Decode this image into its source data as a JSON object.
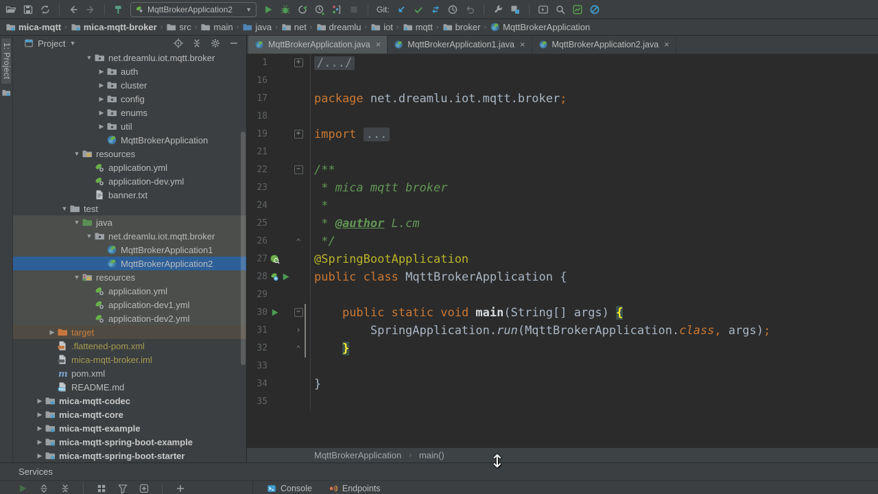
{
  "colors": {
    "selection": "#2d6099",
    "keyword": "#cc7832",
    "annotation": "#bbb529",
    "comment": "#629755",
    "run_green": "#4d9b53",
    "git_blue": "#3f9fd4",
    "excluded_orange": "#c97e3f",
    "ignored_olive": "#a29c4f"
  },
  "toolbar": {
    "run_config": "MqttBrokerApplication2",
    "git_label": "Git:"
  },
  "navbar": {
    "items": [
      {
        "label": "mica-mqtt",
        "icon": "module",
        "bold": true
      },
      {
        "label": "mica-mqtt-broker",
        "icon": "module",
        "bold": true
      },
      {
        "label": "src",
        "icon": "folder"
      },
      {
        "label": "main",
        "icon": "folder"
      },
      {
        "label": "java",
        "icon": "folder-blue"
      },
      {
        "label": "net",
        "icon": "package-crumb"
      },
      {
        "label": "dreamlu",
        "icon": "package-crumb"
      },
      {
        "label": "iot",
        "icon": "package-crumb"
      },
      {
        "label": "mqtt",
        "icon": "package-crumb"
      },
      {
        "label": "broker",
        "icon": "package-crumb"
      },
      {
        "label": "MqttBrokerApplication",
        "icon": "spring"
      }
    ]
  },
  "project": {
    "stripe_label": "1: Project",
    "title": "Project",
    "services_label": "Services",
    "tree": [
      {
        "l": "net.dreamlu.iot.mqtt.broker",
        "i": "package",
        "d": 5,
        "e": "o"
      },
      {
        "l": "auth",
        "i": "package",
        "d": 6,
        "e": "c"
      },
      {
        "l": "cluster",
        "i": "package",
        "d": 6,
        "e": "c"
      },
      {
        "l": "config",
        "i": "package",
        "d": 6,
        "e": "c"
      },
      {
        "l": "enums",
        "i": "package",
        "d": 6,
        "e": "c"
      },
      {
        "l": "util",
        "i": "package",
        "d": 6,
        "e": "c"
      },
      {
        "l": "MqttBrokerApplication",
        "i": "spring",
        "d": 6
      },
      {
        "l": "resources",
        "i": "resources",
        "d": 4,
        "e": "o"
      },
      {
        "l": "application.yml",
        "i": "yml",
        "d": 5
      },
      {
        "l": "application-dev.yml",
        "i": "yml",
        "d": 5
      },
      {
        "l": "banner.txt",
        "i": "txt",
        "d": 5
      },
      {
        "l": "test",
        "i": "folder",
        "d": 3,
        "e": "o"
      },
      {
        "l": "java",
        "i": "folder-green",
        "d": 4,
        "e": "o",
        "s": "hl"
      },
      {
        "l": "net.dreamlu.iot.mqtt.broker",
        "i": "package",
        "d": 5,
        "e": "o",
        "s": "hl"
      },
      {
        "l": "MqttBrokerApplication1",
        "i": "spring",
        "d": 6,
        "s": "hl"
      },
      {
        "l": "MqttBrokerApplication2",
        "i": "spring",
        "d": 6,
        "s": "sel"
      },
      {
        "l": "resources",
        "i": "resources-test",
        "d": 4,
        "e": "o",
        "s": "hl"
      },
      {
        "l": "application.yml",
        "i": "yml",
        "d": 5,
        "s": "hl"
      },
      {
        "l": "application-dev1.yml",
        "i": "yml",
        "d": 5,
        "s": "hl"
      },
      {
        "l": "application-dev2.yml",
        "i": "yml",
        "d": 5,
        "s": "hl"
      },
      {
        "l": "target",
        "i": "folder-orange",
        "d": 2,
        "e": "c",
        "s": "warm",
        "c": "orange"
      },
      {
        "l": ".flattened-pom.xml",
        "i": "xml-file",
        "d": 2,
        "c": "olive"
      },
      {
        "l": "mica-mqtt-broker.iml",
        "i": "iml-file",
        "d": 2,
        "c": "olive"
      },
      {
        "l": "pom.xml",
        "i": "maven",
        "d": 2
      },
      {
        "l": "README.md",
        "i": "md",
        "d": 2
      },
      {
        "l": "mica-mqtt-codec",
        "i": "module",
        "d": 1,
        "e": "c",
        "c": "bold"
      },
      {
        "l": "mica-mqtt-core",
        "i": "module",
        "d": 1,
        "e": "c",
        "c": "bold"
      },
      {
        "l": "mica-mqtt-example",
        "i": "module",
        "d": 1,
        "e": "c",
        "c": "bold"
      },
      {
        "l": "mica-mqtt-spring-boot-example",
        "i": "module",
        "d": 1,
        "e": "c",
        "c": "bold"
      },
      {
        "l": "mica-mqtt-spring-boot-starter",
        "i": "module",
        "d": 1,
        "e": "c",
        "c": "bold"
      }
    ]
  },
  "editor": {
    "tabs": [
      {
        "label": "MqttBrokerApplication.java",
        "icon": "spring",
        "active": true
      },
      {
        "label": "MqttBrokerApplication1.java",
        "icon": "spring",
        "active": false
      },
      {
        "label": "MqttBrokerApplication2.java",
        "icon": "spring",
        "active": false
      }
    ],
    "breadcrumb": [
      "MqttBrokerApplication",
      "main()"
    ],
    "lines": [
      {
        "n": "1",
        "f": "plus",
        "segs": [
          [
            "/.../",
            "folded"
          ]
        ]
      },
      {
        "n": "16",
        "segs": []
      },
      {
        "n": "17",
        "segs": [
          [
            "package",
            "kw"
          ],
          [
            " net.dreamlu.iot.mqtt.broker",
            "pl"
          ],
          [
            ";",
            "kw"
          ]
        ]
      },
      {
        "n": "18",
        "segs": []
      },
      {
        "n": "19",
        "f": "plus",
        "segs": [
          [
            "import",
            "kw"
          ],
          [
            " ",
            "pl"
          ],
          [
            "...",
            "folded"
          ]
        ]
      },
      {
        "n": "21",
        "segs": []
      },
      {
        "n": "22",
        "f": "minus",
        "segs": [
          [
            "/**",
            "doc"
          ]
        ]
      },
      {
        "n": "23",
        "segs": [
          [
            " * ",
            "doc"
          ],
          [
            "mica mqtt broker",
            "doci"
          ]
        ]
      },
      {
        "n": "24",
        "segs": [
          [
            " *",
            "doc"
          ]
        ]
      },
      {
        "n": "25",
        "segs": [
          [
            " * ",
            "doc"
          ],
          [
            "@author",
            "doct"
          ],
          [
            " ",
            "doc"
          ],
          [
            "L.cm",
            "doci"
          ]
        ]
      },
      {
        "n": "26",
        "f": "up",
        "segs": [
          [
            " */",
            "doc"
          ]
        ]
      },
      {
        "n": "27",
        "g": [
          "spring-search"
        ],
        "segs": [
          [
            "@SpringBootApplication",
            "ann"
          ]
        ]
      },
      {
        "n": "28",
        "g": [
          "spring-bean",
          "run"
        ],
        "segs": [
          [
            "public ",
            "kw"
          ],
          [
            "class ",
            "kw"
          ],
          [
            "MqttBrokerApplication",
            "pl"
          ],
          [
            " {",
            "pl"
          ]
        ]
      },
      {
        "n": "29",
        "segs": []
      },
      {
        "n": "30",
        "g": [
          "run"
        ],
        "f": "minus",
        "vcs": true,
        "segs": [
          [
            "    ",
            "pl"
          ],
          [
            "public static void ",
            "kw"
          ],
          [
            "main",
            "meth"
          ],
          [
            "(String[] args) ",
            "pl"
          ],
          [
            "{",
            "brace"
          ]
        ]
      },
      {
        "n": "31",
        "f": "chev",
        "vcs": true,
        "segs": [
          [
            "        SpringApplication.",
            "pl"
          ],
          [
            "run",
            "pli"
          ],
          [
            "(MqttBrokerApplication.",
            "pl"
          ],
          [
            "class",
            "kwi"
          ],
          [
            ",",
            "kw"
          ],
          [
            " args)",
            "pl"
          ],
          [
            ";",
            "kw"
          ]
        ]
      },
      {
        "n": "32",
        "f": "up",
        "vcs": true,
        "segs": [
          [
            "    ",
            "pl"
          ],
          [
            "}",
            "brace"
          ]
        ]
      },
      {
        "n": "33",
        "segs": []
      },
      {
        "n": "34",
        "segs": [
          [
            "}",
            "pl"
          ]
        ]
      },
      {
        "n": "35",
        "segs": []
      }
    ]
  },
  "services_bar": {
    "tabs": [
      {
        "label": "Console",
        "icon": "console"
      },
      {
        "label": "Endpoints",
        "icon": "endpoints"
      }
    ]
  }
}
